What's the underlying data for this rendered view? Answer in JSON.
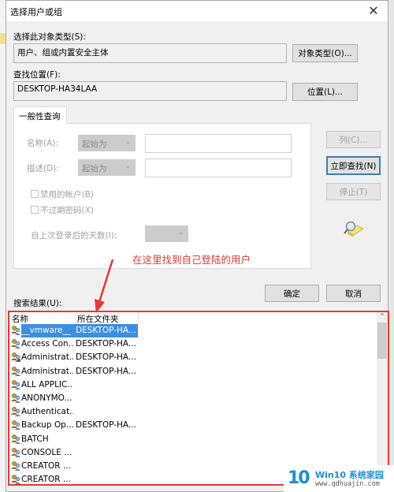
{
  "window": {
    "title": "选择用户或组",
    "close_icon": "close-icon"
  },
  "object_type": {
    "label": "选择此对象类型(S):",
    "value": "用户、组或内置安全主体",
    "button": "对象类型(O)..."
  },
  "location": {
    "label": "查找位置(F):",
    "value": "DESKTOP-HA34LAA",
    "button": "位置(L)..."
  },
  "query": {
    "tab_label": "一般性查询",
    "name_label": "名称(A):",
    "name_combo": "起始为",
    "name_value": "",
    "desc_label": "描述(D):",
    "desc_combo": "起始为",
    "desc_value": "",
    "disabled_accounts_label": "禁用的帐户(B)",
    "disabled_accounts_checked": false,
    "non_expiring_label": "不过期密码(X)",
    "non_expiring_checked": false,
    "days_label": "自上次登录后的天数(I):",
    "days_value": ""
  },
  "side_buttons": {
    "columns": "列(C)...",
    "find_now": "立即查找(N)",
    "stop": "停止(T)",
    "search_icon": "search-magnifier-icon"
  },
  "footer": {
    "ok": "确定",
    "cancel": "取消",
    "results_label": "搜索结果(U):"
  },
  "annotation": {
    "text": "在这里找到自己登陆的用户",
    "color": "#e53935"
  },
  "results": {
    "columns": [
      "名称",
      "所在文件夹"
    ],
    "rows": [
      {
        "name": "__vmware__",
        "folder": "DESKTOP-HA...",
        "icon": "group-icon",
        "selected": true
      },
      {
        "name": "Access Con...",
        "folder": "DESKTOP-HA...",
        "icon": "group-icon",
        "selected": false
      },
      {
        "name": "Administrat...",
        "folder": "DESKTOP-HA...",
        "icon": "user-icon",
        "selected": false
      },
      {
        "name": "Administrat...",
        "folder": "DESKTOP-HA...",
        "icon": "group-icon",
        "selected": false
      },
      {
        "name": "ALL APPLIC...",
        "folder": "",
        "icon": "group-icon",
        "selected": false
      },
      {
        "name": "ANONYMO...",
        "folder": "",
        "icon": "group-icon",
        "selected": false
      },
      {
        "name": "Authenticat...",
        "folder": "",
        "icon": "group-icon",
        "selected": false
      },
      {
        "name": "Backup Op...",
        "folder": "DESKTOP-HA...",
        "icon": "group-icon",
        "selected": false
      },
      {
        "name": "BATCH",
        "folder": "",
        "icon": "group-icon",
        "selected": false
      },
      {
        "name": "CONSOLE ...",
        "folder": "",
        "icon": "group-icon",
        "selected": false
      },
      {
        "name": "CREATOR ...",
        "folder": "",
        "icon": "group-icon",
        "selected": false
      },
      {
        "name": "CREATOR ...",
        "folder": "",
        "icon": "group-icon",
        "selected": false
      }
    ]
  },
  "watermark": {
    "logo": "10",
    "brand_prefix": "Win10",
    "brand_cn": "系统家园",
    "site": "www.qdhuajin.com"
  }
}
